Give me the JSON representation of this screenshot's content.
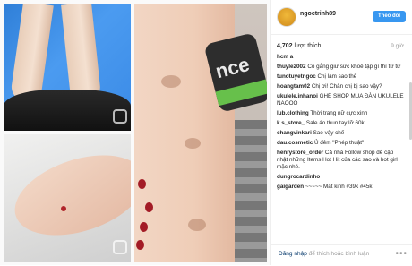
{
  "post": {
    "username": "ngoctrinh89",
    "follow_label": "Theo dõi",
    "likes_count": "4,702",
    "likes_suffix": "lượt thích",
    "time": "9 giờ",
    "comments": [
      {
        "user": "hcm a",
        "text": ""
      },
      {
        "user": "thuyle2002",
        "text": "Cố gắng giữ sức khoẻ tập gì thì từ từ"
      },
      {
        "user": "tunotuyetngoc",
        "text": "Chị làm sao thế"
      },
      {
        "user": "hoangtam02",
        "text": "Chị ơi! Chân chị bị sao vậy?"
      },
      {
        "user": "ukulele.inhanoi",
        "text": "GHÉ SHOP MUA ĐÀN UKULELE NAOOO"
      },
      {
        "user": "lub.clothing",
        "text": "Thời trang nữ cực xinh"
      },
      {
        "user": "k.s_store_",
        "text": "Sale áo thun tay lỡ 60k"
      },
      {
        "user": "changvinkari",
        "text": "Sao vậy chế"
      },
      {
        "user": "dau.cosmetic",
        "text": "Ủ đêm \"Phép thuật\""
      },
      {
        "user": "henrystore_order",
        "text": "Cả nhà Follow shop để cập nhật những Items Hot Hit của các sao và hot girl mặc nhé."
      },
      {
        "user": "dungrocardinho",
        "text": ""
      },
      {
        "user": "gaigarden",
        "text": "~~~~~ Mất kinh #39k #45k"
      }
    ],
    "footer_link": "Đăng nhập",
    "footer_rest": "để thích hoặc bình luận",
    "more_label": "•••"
  }
}
